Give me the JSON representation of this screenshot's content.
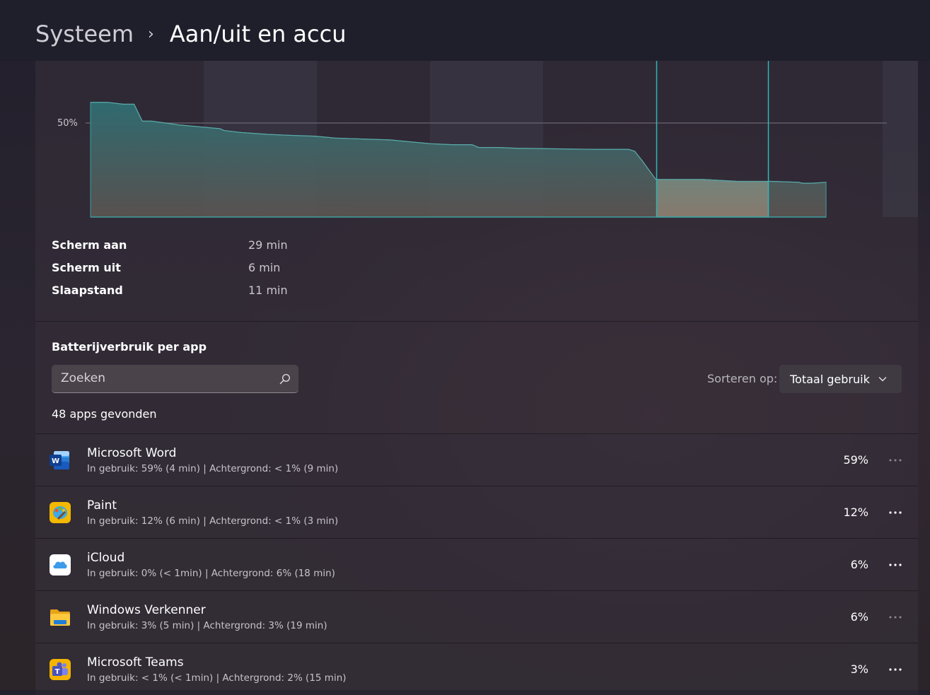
{
  "breadcrumb": {
    "parent": "Systeem",
    "separator": "›",
    "current": "Aan/uit en accu"
  },
  "chart_data": {
    "type": "area",
    "y_tick_label": "50%",
    "segments": 8,
    "selected_segment": 5,
    "ylim": [
      0,
      100
    ],
    "levels": [
      {
        "t": 0.0,
        "v": 61
      },
      {
        "t": 2.5,
        "v": 61
      },
      {
        "t": 4.8,
        "v": 60
      },
      {
        "t": 6.4,
        "v": 60
      },
      {
        "t": 7.6,
        "v": 51
      },
      {
        "t": 9.0,
        "v": 51
      },
      {
        "t": 11.0,
        "v": 50
      },
      {
        "t": 13.0,
        "v": 49
      },
      {
        "t": 16.0,
        "v": 48
      },
      {
        "t": 19.0,
        "v": 47
      },
      {
        "t": 19.6,
        "v": 46
      },
      {
        "t": 22.0,
        "v": 45
      },
      {
        "t": 26.0,
        "v": 44
      },
      {
        "t": 29.0,
        "v": 43.5
      },
      {
        "t": 33.0,
        "v": 43
      },
      {
        "t": 36.0,
        "v": 42
      },
      {
        "t": 40.0,
        "v": 41.5
      },
      {
        "t": 44.0,
        "v": 41
      },
      {
        "t": 47.0,
        "v": 40
      },
      {
        "t": 50.0,
        "v": 39
      },
      {
        "t": 53.0,
        "v": 38.5
      },
      {
        "t": 56.0,
        "v": 38.5
      },
      {
        "t": 57.0,
        "v": 37
      },
      {
        "t": 60.0,
        "v": 37
      },
      {
        "t": 63.0,
        "v": 36.5
      },
      {
        "t": 64.0,
        "v": 36.5
      },
      {
        "t": 74.0,
        "v": 36
      },
      {
        "t": 79.0,
        "v": 36
      },
      {
        "t": 79.9,
        "v": 35
      },
      {
        "t": 81.0,
        "v": 30
      },
      {
        "t": 82.0,
        "v": 25
      },
      {
        "t": 83.0,
        "v": 20
      },
      {
        "t": 84.0,
        "v": 20
      },
      {
        "t": 90.0,
        "v": 20
      },
      {
        "t": 95.0,
        "v": 19
      },
      {
        "t": 100.0,
        "v": 19
      },
      {
        "t": 104.0,
        "v": 18.5
      },
      {
        "t": 104.5,
        "v": 18
      },
      {
        "t": 106.0,
        "v": 18
      },
      {
        "t": 108.0,
        "v": 18.5
      }
    ],
    "t_max": 108.0,
    "colors": {
      "fill": "#3a7478",
      "stroke": "#3d9fa0",
      "gridline": "#6a6670",
      "highlight": "#2fb7b5"
    }
  },
  "stats": [
    {
      "label": "Scherm aan",
      "value": "29 min"
    },
    {
      "label": "Scherm uit",
      "value": "6 min"
    },
    {
      "label": "Slaapstand",
      "value": "11 min"
    }
  ],
  "usage": {
    "title": "Batterijverbruik per app",
    "search_placeholder": "Zoeken",
    "sort_label": "Sorteren op:",
    "sort_value": "Totaal gebruik",
    "apps_count": "48 apps gevonden"
  },
  "apps": [
    {
      "name": "Microsoft Word",
      "detail": "In gebruik: 59% (4 min) | Achtergrond: < 1% (9 min)",
      "percent": "59%",
      "icon": "word-icon"
    },
    {
      "name": "Paint",
      "detail": "In gebruik: 12% (6 min) | Achtergrond: < 1% (3 min)",
      "percent": "12%",
      "icon": "paint-icon"
    },
    {
      "name": "iCloud",
      "detail": "In gebruik: 0% (< 1min) | Achtergrond: 6% (18 min)",
      "percent": "6%",
      "icon": "icloud-icon"
    },
    {
      "name": "Windows Verkenner",
      "detail": "In gebruik: 3% (5 min) | Achtergrond: 3% (19 min)",
      "percent": "6%",
      "icon": "folder-icon"
    },
    {
      "name": "Microsoft Teams",
      "detail": "In gebruik: < 1% (< 1min) | Achtergrond: 2% (15 min)",
      "percent": "3%",
      "icon": "teams-icon"
    }
  ]
}
